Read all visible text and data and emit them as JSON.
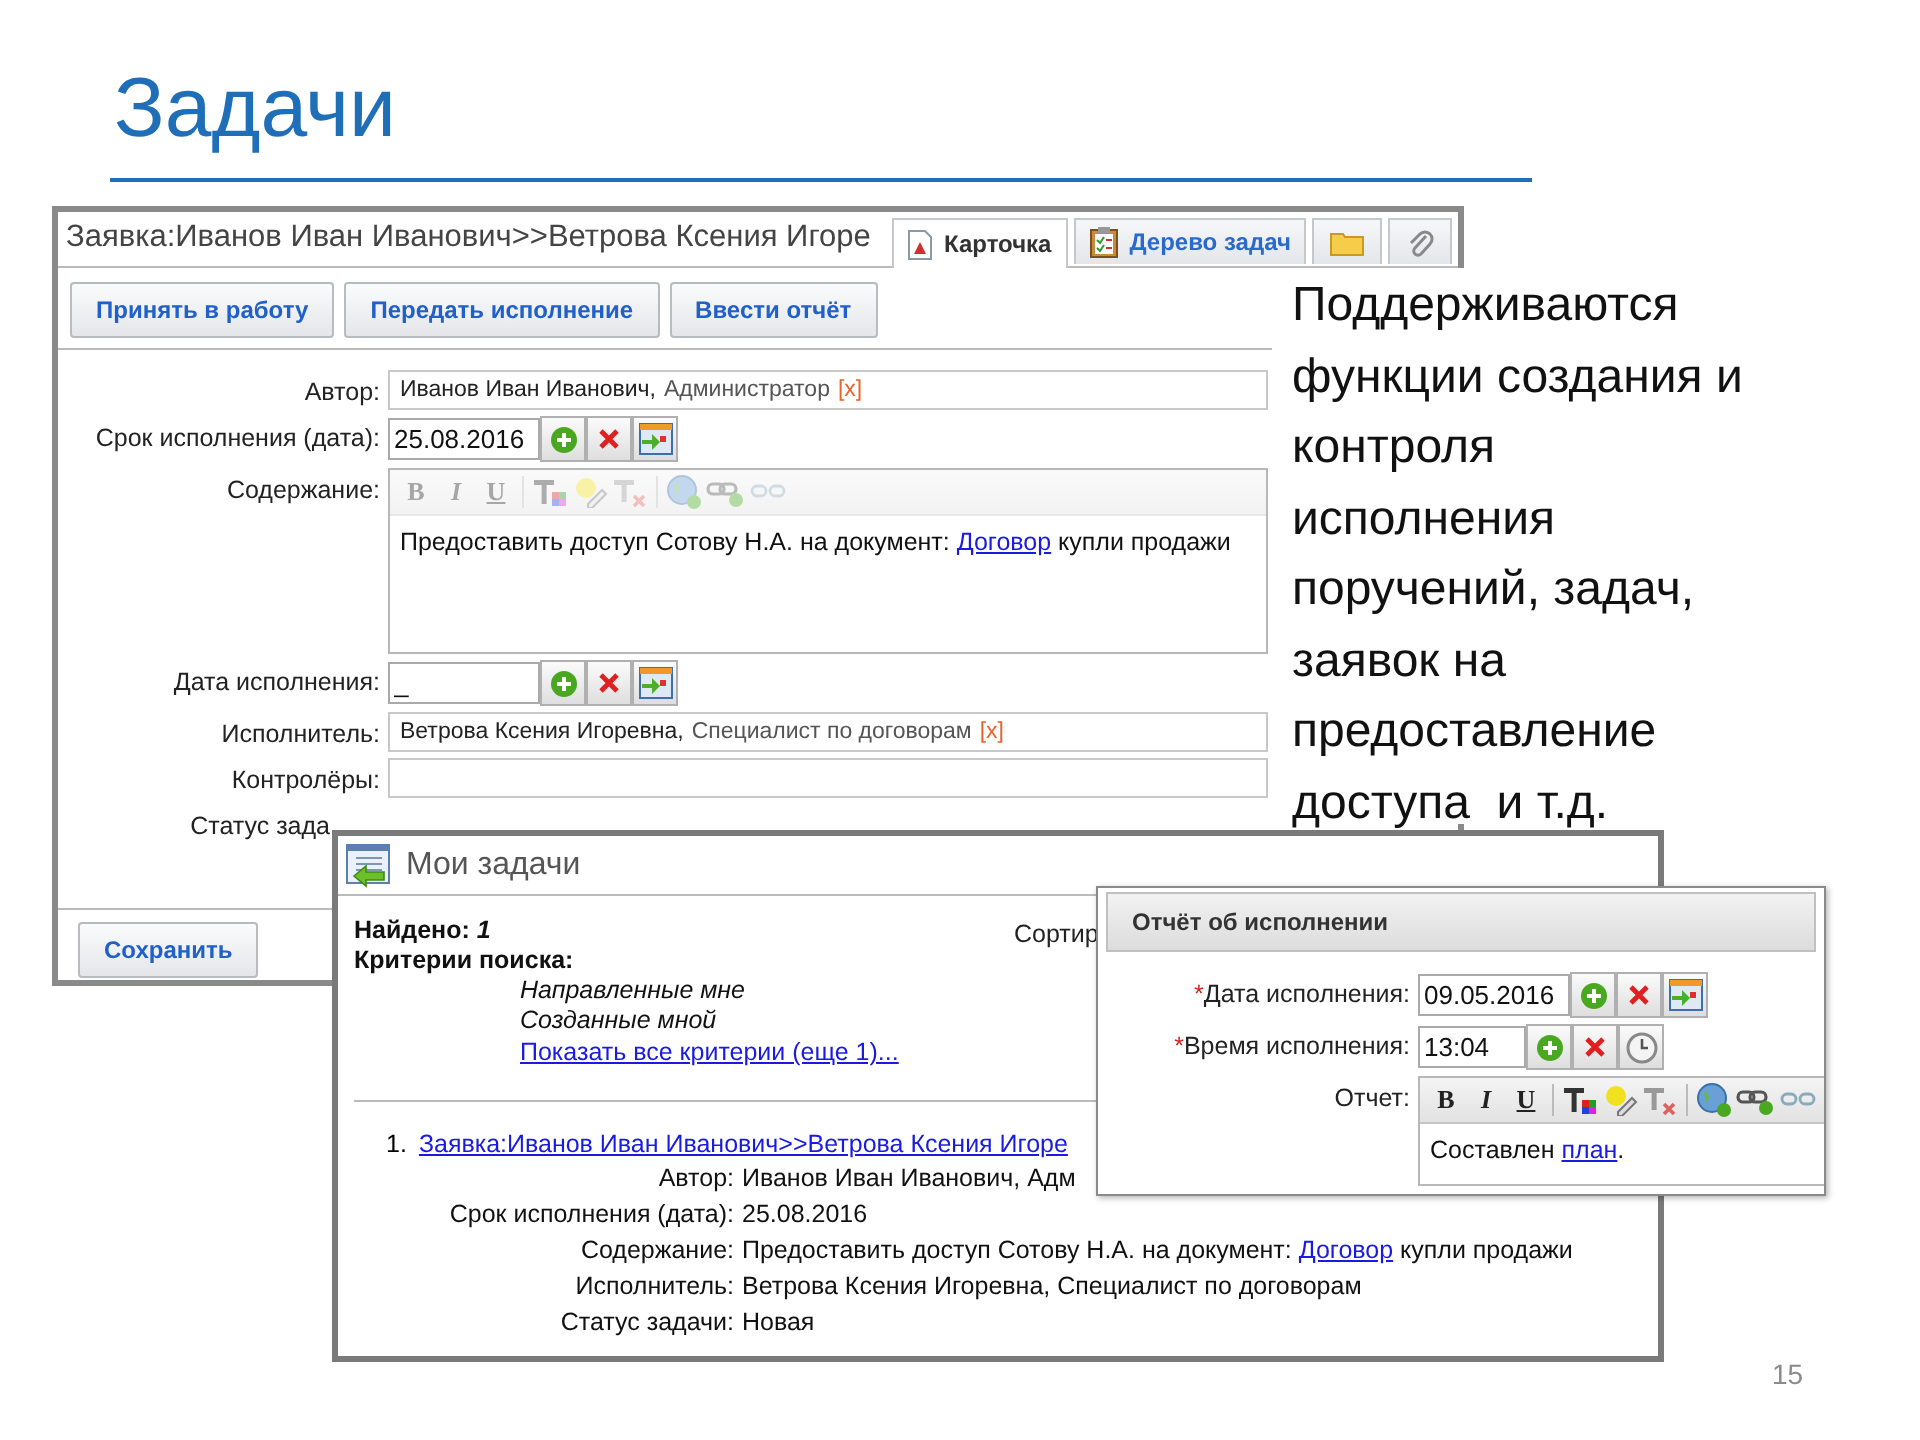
{
  "slide": {
    "title": "Задачи",
    "callout": "Поддерживаются\nфункции создания и\nконтроля\nисполнения\nпоручений, задач,\nзаявок на\nпредоставление\nдоступа  и т.д.",
    "page_number": "15"
  },
  "card_window": {
    "title": "Заявка:Иванов Иван Иванович>>Ветрова Ксения Игоре",
    "tabs": [
      {
        "label": "Карточка",
        "selected": true
      },
      {
        "label": "Дерево задач",
        "selected": false
      },
      {
        "selected": false
      },
      {
        "selected": false
      }
    ],
    "buttons": [
      "Принять в работу",
      "Передать исполнение",
      "Ввести отчёт"
    ],
    "fields": [
      {
        "kind": "person",
        "label": "Автор:",
        "name": "Иванов Иван Иванович,",
        "role": "Администратор",
        "remove": "[x]"
      },
      {
        "kind": "date",
        "label": "Срок исполнения (дата):",
        "value": "25.08.2016"
      },
      {
        "kind": "richtext",
        "label": "Содержание:",
        "toolbar": {
          "disabled": true,
          "format_keys": [
            "B",
            "I",
            "U"
          ]
        },
        "before": "Предоставить доступ Сотову Н.А. на документ: ",
        "link": "Договор",
        "after": " купли продажи"
      },
      {
        "kind": "date",
        "label": "Дата исполнения:",
        "value": "_"
      },
      {
        "kind": "person",
        "label": "Исполнитель:",
        "name": "Ветрова Ксения Игоревна,",
        "role": "Специалист по договорам",
        "remove": "[x]"
      },
      {
        "kind": "empty",
        "label": "Контролёры:"
      },
      {
        "kind": "label",
        "label": "Статус зада"
      }
    ],
    "save_button": "Сохранить"
  },
  "tasks_window": {
    "title": "Мои задачи",
    "found": "Найдено: *1*",
    "criteria_label": "Критерии поиска:",
    "criteria": [
      "Направленные мне",
      "Созданные мной"
    ],
    "show_all_link": "Показать все критерии (еще 1)...",
    "sort_label": "Сортир",
    "results": [
      {
        "number": "1.",
        "link": "Заявка:Иванов Иван Иванович>>Ветрова Ксения Игоре",
        "fields": [
          {
            "label": "Автор:",
            "value": "Иванов Иван Иванович, Адм"
          },
          {
            "label": "Срок исполнения (дата):",
            "value": "25.08.2016"
          },
          {
            "label": "Содержание:",
            "before": "Предоставить доступ Сотову Н.А. на документ: ",
            "link": "Договор",
            "after": " купли продажи"
          },
          {
            "label": "Исполнитель:",
            "value": "Ветрова Ксения Игоревна, Специалист по договорам"
          },
          {
            "label": "Статус задачи:",
            "value": "Новая"
          }
        ]
      }
    ]
  },
  "report_window": {
    "title": "Отчёт об исполнении",
    "fields": [
      {
        "kind": "date",
        "mark": "*",
        "label": "Дата исполнения:",
        "value": "09.05.2016"
      },
      {
        "kind": "time",
        "mark": "*",
        "label": "Время исполнения:",
        "value": "13:04"
      },
      {
        "kind": "richtext",
        "label": "Отчет:",
        "toolbar": {
          "disabled": false,
          "format_keys": [
            "B",
            "I",
            "U"
          ]
        },
        "before": "Составлен ",
        "link": "план",
        "after": "."
      }
    ]
  }
}
